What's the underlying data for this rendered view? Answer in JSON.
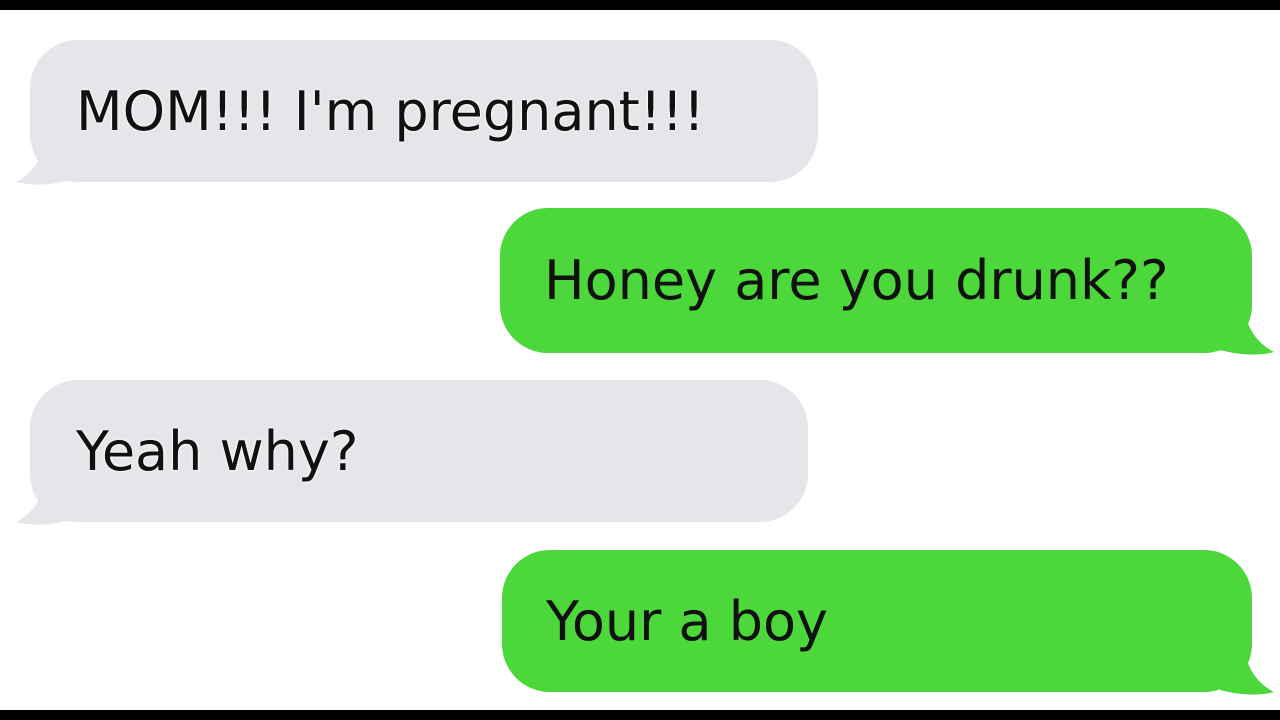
{
  "conversation": {
    "messages": [
      {
        "direction": "incoming",
        "text": "MOM!!! I'm pregnant!!!"
      },
      {
        "direction": "outgoing",
        "text": "Honey are you drunk??"
      },
      {
        "direction": "incoming",
        "text": "Yeah why?"
      },
      {
        "direction": "outgoing",
        "text": "Your a boy"
      }
    ]
  },
  "colors": {
    "incoming_bubble": "#e5e5ea",
    "outgoing_bubble": "#4cd73b",
    "text": "#111111",
    "background": "#ffffff",
    "frame_bars": "#000000"
  }
}
